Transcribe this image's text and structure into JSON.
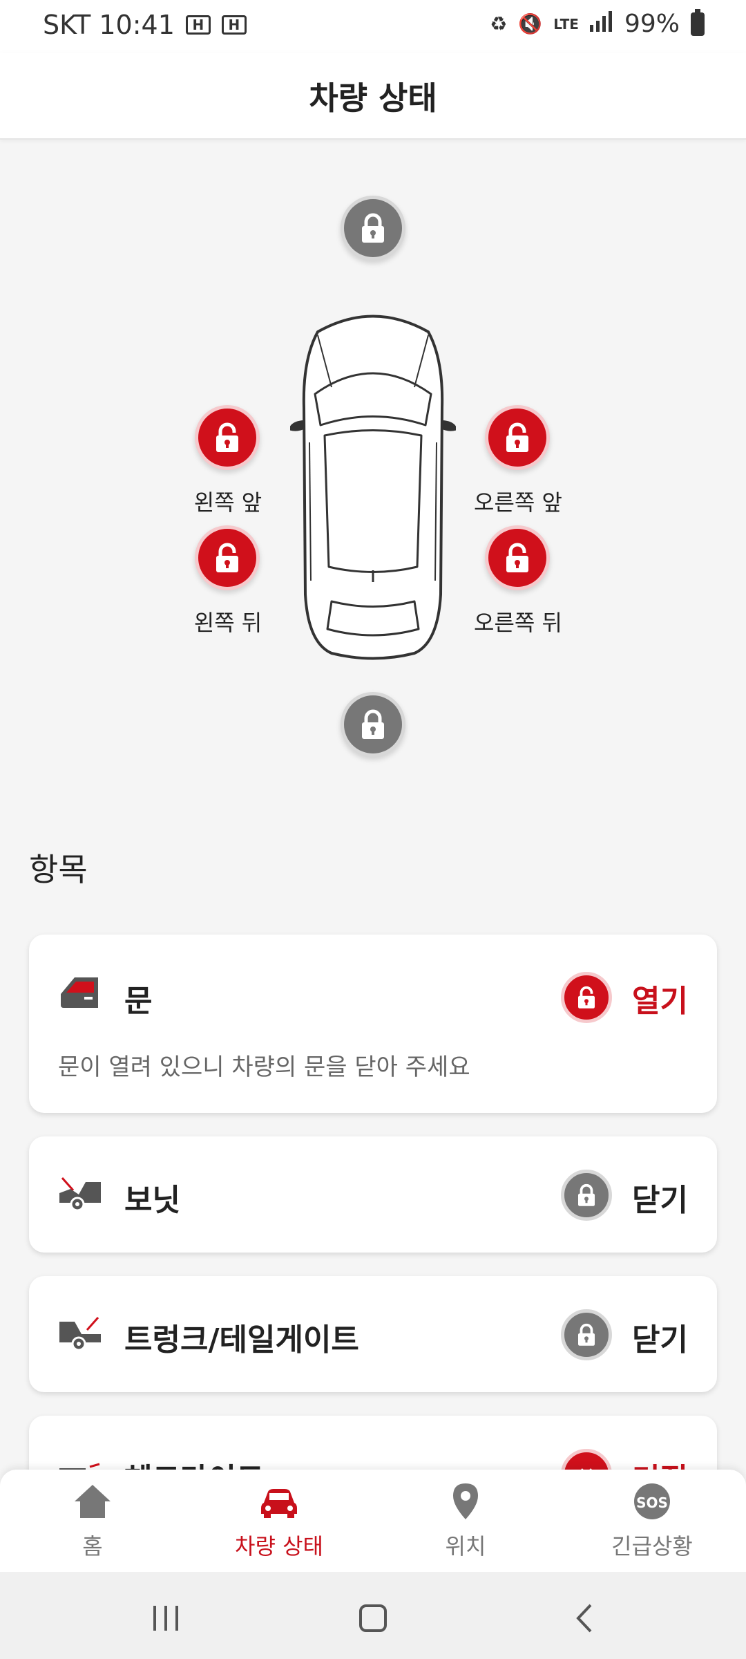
{
  "status_bar": {
    "carrier_time": "SKT 10:41",
    "badge_1": "H",
    "badge_2": "H",
    "network": "LTE",
    "battery": "99%"
  },
  "header": {
    "title": "차량 상태"
  },
  "diagram": {
    "front_left": "왼쪽 앞",
    "front_right": "오른쪽 앞",
    "rear_left": "왼쪽 뒤",
    "rear_right": "오른쪽 뒤"
  },
  "items_section": {
    "title": "항목"
  },
  "items": [
    {
      "title": "문",
      "status": "열기",
      "state": "open",
      "description": "문이 열려 있으니 차량의 문을 닫아 주세요"
    },
    {
      "title": "보닛",
      "status": "닫기",
      "state": "closed"
    },
    {
      "title": "트렁크/테일게이트",
      "status": "닫기",
      "state": "closed"
    },
    {
      "title": "헤드라이트",
      "status": "켜짐",
      "state": "on"
    }
  ],
  "bottom_nav": {
    "home": "홈",
    "vehicle_status": "차량 상태",
    "location": "위치",
    "emergency": "긴급상황",
    "emergency_icon_text": "SOS"
  },
  "colors": {
    "accent": "#c8101b",
    "locked_gray": "#777777"
  }
}
